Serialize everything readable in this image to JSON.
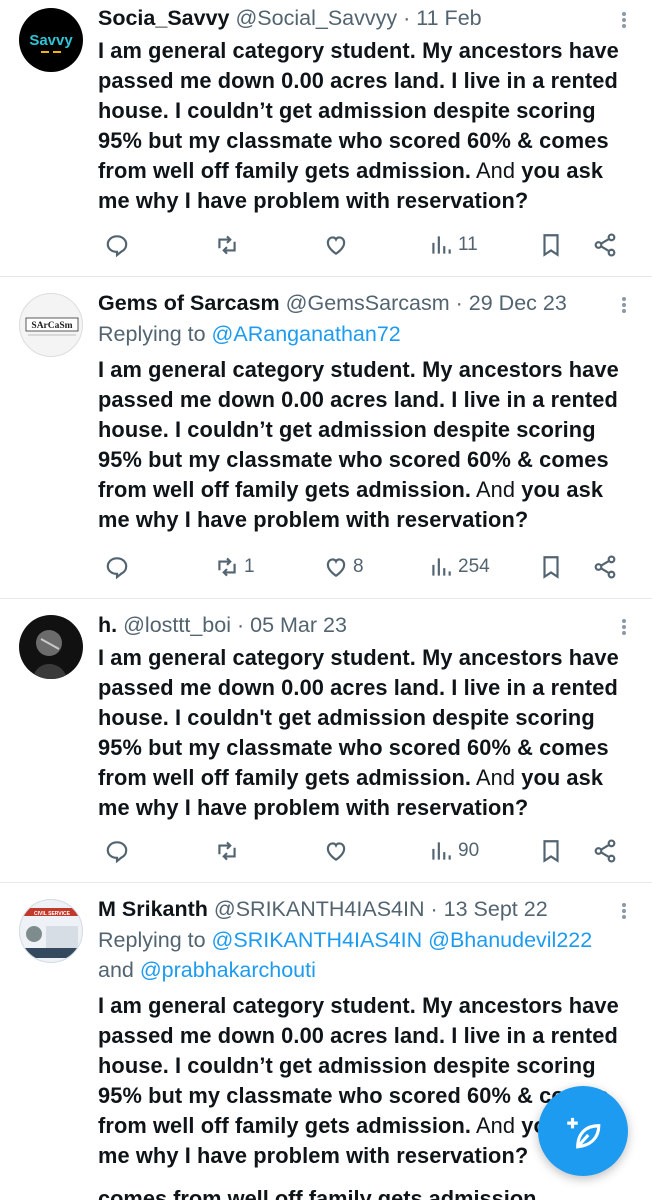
{
  "tweets": [
    {
      "name": "Socia_Savvy",
      "handle": "@Social_Savvyy",
      "dot": "·",
      "date": "11 Feb",
      "reply_prefix": "",
      "reply_to": "",
      "text_bold_1": "I am general category student. My ancestors have passed me down 0.00 acres land. I live in a rented house. I couldn’t get admission despite scoring 95% but my classmate who scored 60% & comes from well off family gets admission.",
      "text_plain": " And ",
      "text_bold_2": "you ask me why I have problem with reservation?",
      "retweets": "",
      "likes": "",
      "views": "11",
      "avatar_label": "Savvy"
    },
    {
      "name": "Gems of Sarcasm",
      "handle": "@GemsSarcasm",
      "dot": "·",
      "date": "29 Dec 23",
      "reply_prefix": "Replying to ",
      "reply_to": "@ARanganathan72",
      "text_bold_1": "I am general category student. My ancestors have passed me down 0.00 acres land. I live in a rented house. I couldn’t get admission despite scoring 95% but my classmate who scored 60% & comes from well off family gets admission.",
      "text_plain": " And ",
      "text_bold_2": "you ask me why I have problem with reservation?",
      "retweets": "1",
      "likes": "8",
      "views": "254",
      "avatar_label": "SArCaSm"
    },
    {
      "name": "h.",
      "handle": "@losttt_boi",
      "dot": "·",
      "date": "05 Mar 23",
      "reply_prefix": "",
      "reply_to": "",
      "text_bold_1": "I am general category student. My ancestors have passed me down 0.00 acres land. I live in a rented house. I couldn't get admission despite scoring 95% but my classmate who scored 60% & comes from well off family gets admission.",
      "text_plain": " And ",
      "text_bold_2": "you ask me why I have problem with reservation?",
      "retweets": "",
      "likes": "",
      "views": "90",
      "avatar_label": ""
    },
    {
      "name": "M Srikanth",
      "handle": "@SRIKANTH4IAS4IN",
      "dot": "·",
      "date": "13 Sept 22",
      "reply_prefix": "Replying to ",
      "reply_to": "@SRIKANTH4IAS4IN @Bhanudevil222",
      "reply_and": "and ",
      "reply_to_2": "@prabhakarchouti",
      "text_bold_1": "I am general category student. My ancestors have passed me down 0.00 acres land. I live in a rented house. I couldn’t get admission despite scoring 95% but my classmate who scored 60% & comes from well off family gets admission.",
      "text_plain": " And ",
      "text_bold_2": "you ask me why I have problem with reservation?",
      "avatar_label": "CIVIL SERVICE"
    }
  ],
  "cutoff_text": "comes from well off family gets admission",
  "colors": {
    "accent": "#1d9bf0",
    "secondary_text": "#536471",
    "primary_text": "#0f1419"
  },
  "icons": [
    "reply-icon",
    "retweet-icon",
    "like-icon",
    "views-icon",
    "bookmark-icon",
    "share-icon",
    "more-icon",
    "compose-icon"
  ]
}
